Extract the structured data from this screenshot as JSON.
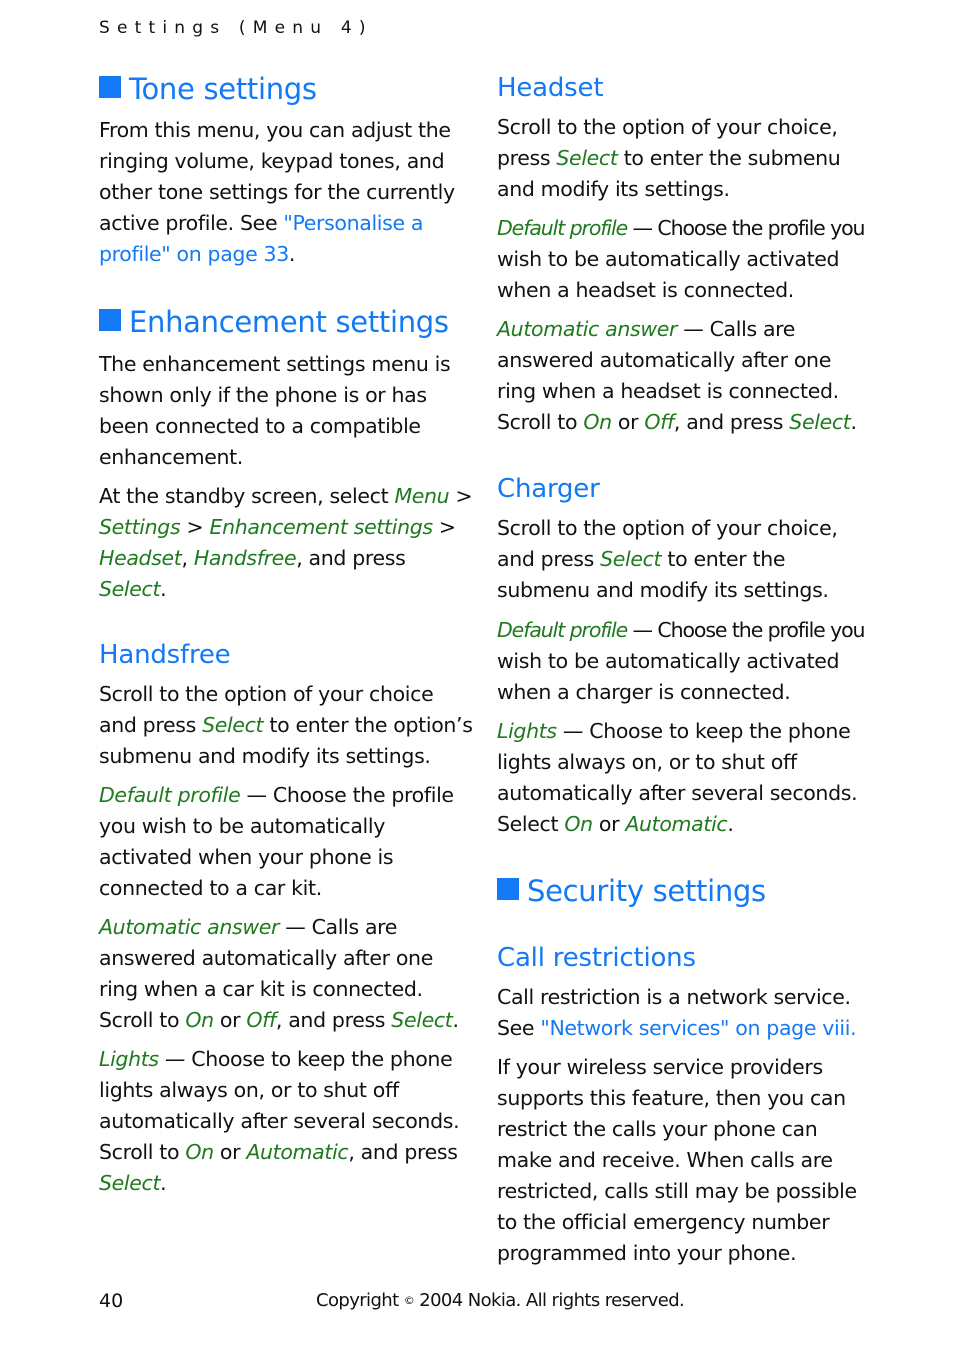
{
  "running_header": "Settings (Menu 4)",
  "colors": {
    "heading": "#1479f5",
    "menu_term": "#1f7a1f",
    "link": "#1479f5",
    "text": "#111111"
  },
  "left": {
    "tone": {
      "title": "Tone settings",
      "lines": [
        [
          "From this menu, you can adjust the"
        ],
        [
          "ringing volume, keypad tones, and"
        ],
        [
          "other tone settings for the currently"
        ],
        [
          "active profile. See ",
          {
            "link": "\"Personalise a"
          }
        ],
        [
          {
            "link": "profile\" on page 33"
          },
          "."
        ]
      ]
    },
    "enhancement": {
      "title": "Enhancement settings",
      "p1": [
        [
          "The enhancement settings menu is"
        ],
        [
          "shown only if the phone is or has"
        ],
        [
          "been connected to a compatible"
        ],
        [
          "enhancement."
        ]
      ],
      "p2": [
        [
          "At the standby screen, select ",
          {
            "g": "Menu"
          },
          " >"
        ],
        [
          {
            "g": "Settings"
          },
          " > ",
          {
            "g": "Enhancement settings"
          },
          " >"
        ],
        [
          {
            "g": "Headset"
          },
          ", ",
          {
            "g": "Handsfree"
          },
          ", and press"
        ],
        [
          {
            "g": "Select"
          },
          "."
        ]
      ]
    },
    "handsfree": {
      "title": "Handsfree",
      "p1": [
        [
          "Scroll to the option of your choice"
        ],
        [
          "and press ",
          {
            "g": "Select"
          },
          " to enter the option’s"
        ],
        [
          "submenu and modify its settings."
        ]
      ],
      "p2": [
        [
          {
            "g": "Default profile"
          },
          " — Choose the profile"
        ],
        [
          "you wish to be automatically"
        ],
        [
          "activated when your phone is"
        ],
        [
          "connected to a car kit."
        ]
      ],
      "p3": [
        [
          {
            "g": "Automatic answer"
          },
          " — Calls are"
        ],
        [
          "answered automatically after one"
        ],
        [
          "ring when a car kit is connected."
        ],
        [
          "Scroll to ",
          {
            "g": "On"
          },
          " or ",
          {
            "g": "Off"
          },
          ", and press ",
          {
            "g": "Select"
          },
          "."
        ]
      ],
      "p4": [
        [
          {
            "g": "Lights"
          },
          " — Choose to keep the phone"
        ],
        [
          "lights always on, or to shut off"
        ],
        [
          "automatically after several seconds."
        ],
        [
          "Scroll to ",
          {
            "g": "On"
          },
          " or ",
          {
            "g": "Automatic"
          },
          ", and press"
        ],
        [
          {
            "g": "Select"
          },
          "."
        ]
      ]
    }
  },
  "right": {
    "headset": {
      "title": "Headset",
      "p1": [
        [
          "Scroll to the option of your choice,"
        ],
        [
          "press ",
          {
            "g": "Select"
          },
          " to enter the submenu"
        ],
        [
          "and modify its settings."
        ]
      ],
      "p2": [
        [
          {
            "g": "Default profile"
          },
          " — Choose the profile you"
        ],
        [
          "wish to be automatically activated"
        ],
        [
          "when a headset is connected."
        ]
      ],
      "p3": [
        [
          {
            "g": "Automatic answer"
          },
          " — Calls are"
        ],
        [
          "answered automatically after one"
        ],
        [
          "ring when a headset is connected."
        ],
        [
          "Scroll to ",
          {
            "g": "On"
          },
          " or ",
          {
            "g": "Off"
          },
          ", and press ",
          {
            "g": "Select"
          },
          "."
        ]
      ]
    },
    "charger": {
      "title": "Charger",
      "p1": [
        [
          "Scroll to the option of your choice,"
        ],
        [
          "and press ",
          {
            "g": "Select"
          },
          " to enter the"
        ],
        [
          "submenu and modify its settings."
        ]
      ],
      "p2": [
        [
          {
            "g": "Default profile"
          },
          " — Choose the profile you"
        ],
        [
          "wish to be automatically activated"
        ],
        [
          "when a charger is connected."
        ]
      ],
      "p3": [
        [
          {
            "g": "Lights"
          },
          " — Choose to keep the phone"
        ],
        [
          "lights always on, or to shut off"
        ],
        [
          "automatically after several seconds."
        ],
        [
          "Select ",
          {
            "g": "On"
          },
          " or ",
          {
            "g": "Automatic"
          },
          "."
        ]
      ]
    },
    "security": {
      "title": "Security settings"
    },
    "call_restrictions": {
      "title": "Call restrictions",
      "p1": [
        [
          "Call restriction is a network service."
        ],
        [
          "See ",
          {
            "link": "\"Network services\" on page viii."
          }
        ]
      ],
      "p2": [
        [
          "If your wireless service providers"
        ],
        [
          "supports this feature, then you can"
        ],
        [
          "restrict the calls your phone can"
        ],
        [
          "make and receive. When calls are"
        ],
        [
          "restricted, calls still may be possible"
        ],
        [
          "to the official emergency number"
        ],
        [
          "programmed into your phone."
        ]
      ]
    }
  },
  "footer": {
    "page_number": "40",
    "copyright_pre": "Copyright",
    "copyright_symbol": "©",
    "copyright_post": "2004 Nokia. All rights reserved."
  }
}
